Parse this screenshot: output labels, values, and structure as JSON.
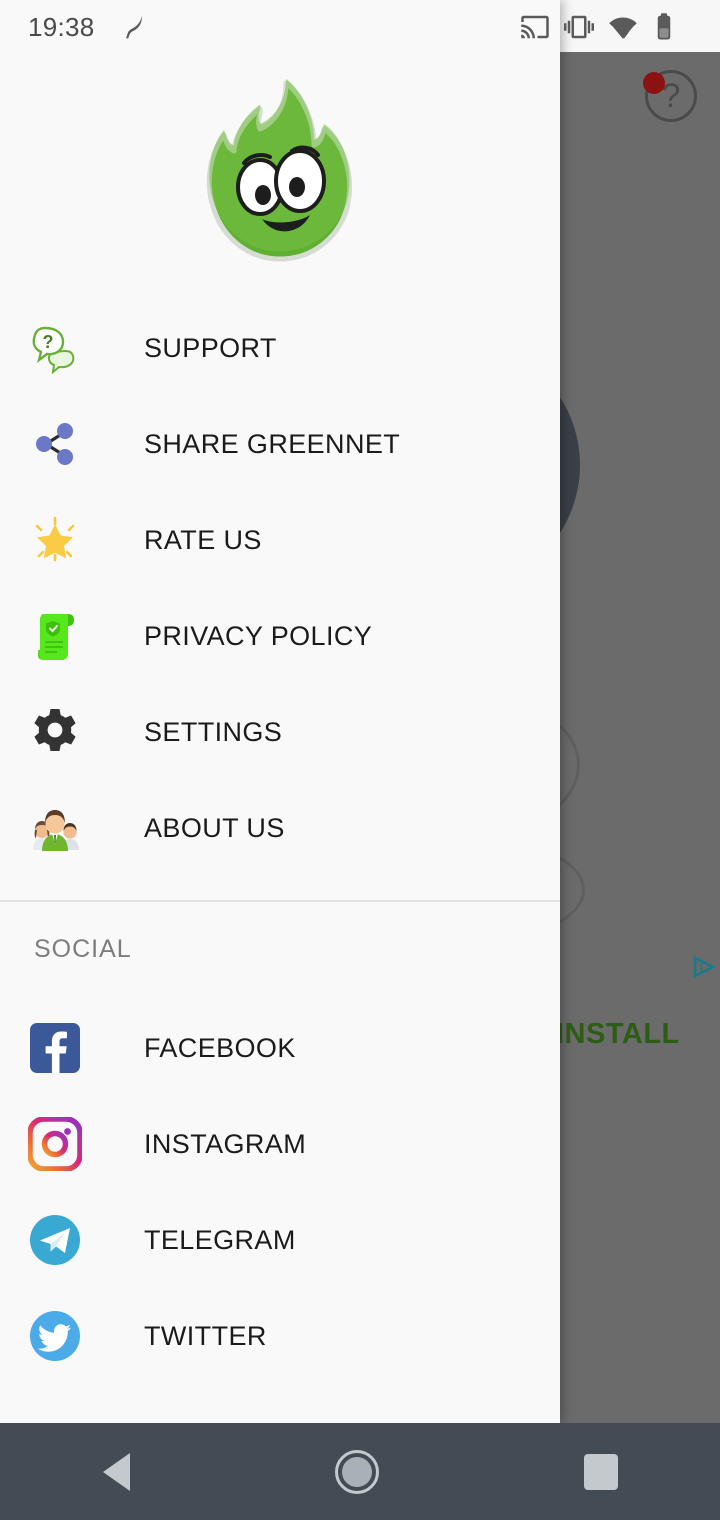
{
  "status_bar": {
    "time": "19:38",
    "icons": [
      "leaf-icon",
      "cast-icon",
      "vibrate-icon",
      "wifi-icon",
      "battery-icon"
    ]
  },
  "drawer": {
    "logo": {
      "name": "greennet-flame-logo",
      "color": "#5faf32",
      "highlight": "#74c043"
    },
    "menu_items": [
      {
        "icon": "support-chat-icon",
        "label": "SUPPORT"
      },
      {
        "icon": "share-nodes-icon",
        "label": "SHARE GREENNET"
      },
      {
        "icon": "star-icon",
        "label": "RATE US"
      },
      {
        "icon": "privacy-scroll-icon",
        "label": "PRIVACY POLICY"
      },
      {
        "icon": "gear-icon",
        "label": "SETTINGS"
      },
      {
        "icon": "people-group-icon",
        "label": "ABOUT US"
      }
    ],
    "social_header": "SOCIAL",
    "social_items": [
      {
        "icon": "facebook-icon",
        "label": "FACEBOOK",
        "color": "#3b5998"
      },
      {
        "icon": "instagram-icon",
        "label": "INSTAGRAM",
        "color": "#c13584"
      },
      {
        "icon": "telegram-icon",
        "label": "TELEGRAM",
        "color": "#34aadc"
      },
      {
        "icon": "twitter-icon",
        "label": "TWITTER",
        "color": "#55acee"
      }
    ]
  },
  "background_app": {
    "help_label": "?",
    "has_notification_dot": true,
    "ad_install_label": "INSTALL",
    "adchoices_icon": "adchoices-icon"
  },
  "nav_bar": {
    "back": "back-button",
    "home": "home-button",
    "recents": "recents-button"
  },
  "colors": {
    "drawer_bg": "#f9f9f9",
    "scrim": "#6b6b6b",
    "nav_bg": "#434c55",
    "text": "#1b1b1b",
    "muted_text": "#7d7d7d",
    "divider": "#e2e2e2",
    "brand_green": "#5faf32",
    "ad_green": "#2d5d14"
  }
}
